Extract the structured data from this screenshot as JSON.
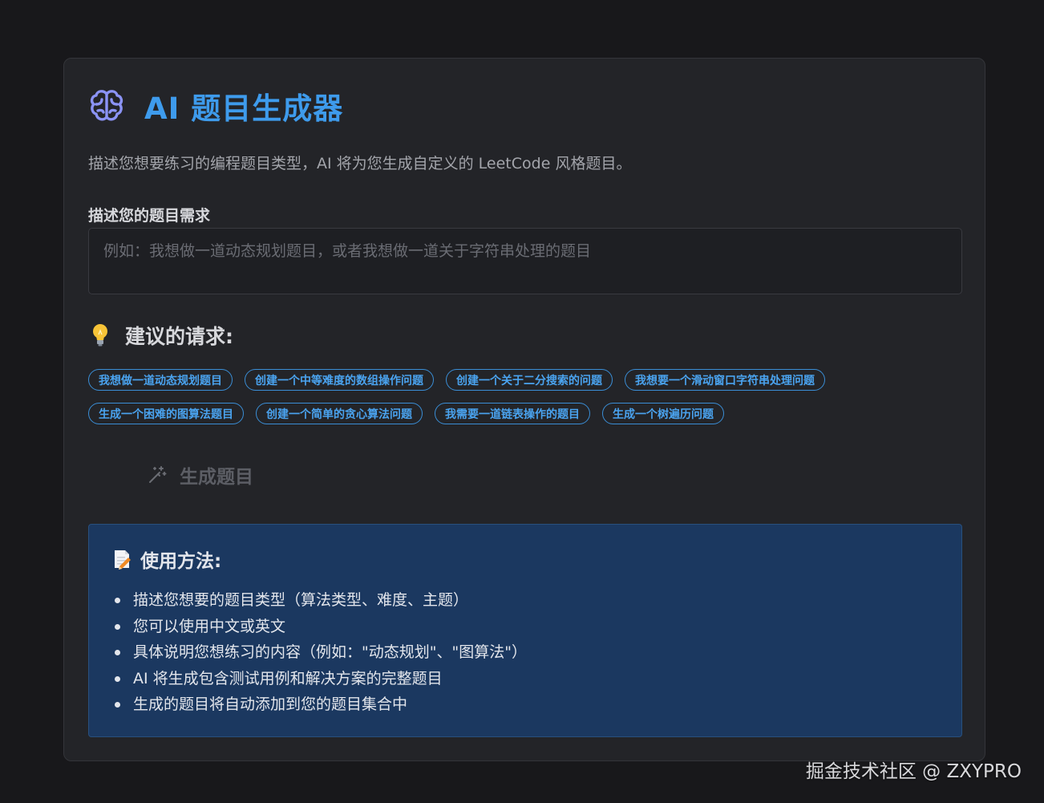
{
  "header": {
    "icon": "brain-icon",
    "title": "AI 题目生成器",
    "subtitle": "描述您想要练习的编程题目类型，AI 将为您生成自定义的 LeetCode 风格题目。"
  },
  "request": {
    "label": "描述您的题目需求",
    "value": "",
    "placeholder": "例如：我想做一道动态规划题目，或者我想做一道关于字符串处理的题目"
  },
  "suggestions": {
    "icon": "lightbulb-icon",
    "title": "建议的请求:",
    "rows": [
      [
        "我想做一道动态规划题目",
        "创建一个中等难度的数组操作问题",
        "创建一个关于二分搜索的问题",
        "我想要一个滑动窗口字符串处理问题"
      ],
      [
        "生成一个困难的图算法题目",
        "创建一个简单的贪心算法问题",
        "我需要一道链表操作的题目",
        "生成一个树遍历问题"
      ]
    ]
  },
  "generate": {
    "icon": "magic-wand-icon",
    "label": "生成题目"
  },
  "usage": {
    "icon": "memo-icon",
    "title": "使用方法:",
    "items": [
      "描述您想要的题目类型（算法类型、难度、主题）",
      "您可以使用中文或英文",
      "具体说明您想练习的内容（例如：\"动态规划\"、\"图算法\"）",
      "AI 将生成包含测试用例和解决方案的完整题目",
      "生成的题目将自动添加到您的题目集合中"
    ]
  },
  "watermark": "掘金技术社区 @ ZXYPRO",
  "colors": {
    "background": "#18181b",
    "card": "#232428",
    "accent": "#3e9bec",
    "info_panel": "#1b3860"
  }
}
